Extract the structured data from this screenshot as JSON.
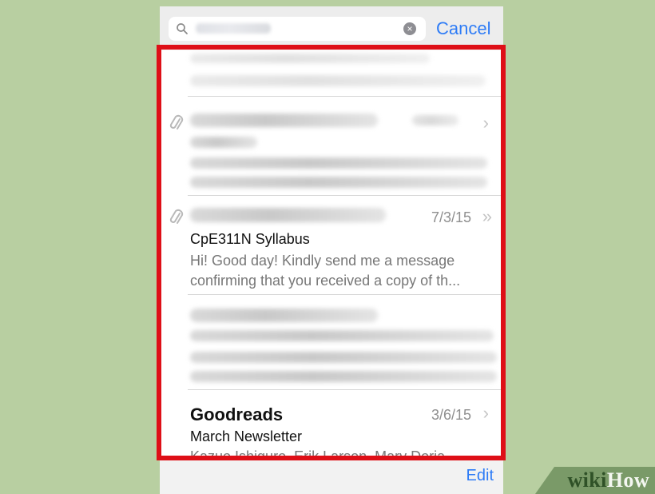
{
  "search": {
    "cancel_label": "Cancel",
    "clear_icon": "clear-icon"
  },
  "messages": [
    {
      "id": "hidden-top",
      "sender": "",
      "date": ""
    },
    {
      "id": "hidden-1",
      "sender": "",
      "date": ""
    },
    {
      "id": "syllabus",
      "sender": "",
      "date": "7/3/15",
      "subject": "CpE311N Syllabus",
      "preview_line_1": "Hi! Good day! Kindly send me a message",
      "preview_line_2": "confirming that you received a copy of th..."
    },
    {
      "id": "hidden-2",
      "sender": "",
      "date": ""
    },
    {
      "id": "goodreads",
      "sender": "Goodreads",
      "date": "3/6/15",
      "subject": "March Newsletter",
      "preview_line_1": "Kazuo Ishiguro, Erik Larson, Mary Doria"
    }
  ],
  "toolbar": {
    "edit_label": "Edit"
  },
  "watermark": {
    "wiki": "wiki",
    "how": "How"
  },
  "colors": {
    "background": "#b8cfa1",
    "highlight": "#de0f17",
    "accent": "#2e7cf6"
  }
}
